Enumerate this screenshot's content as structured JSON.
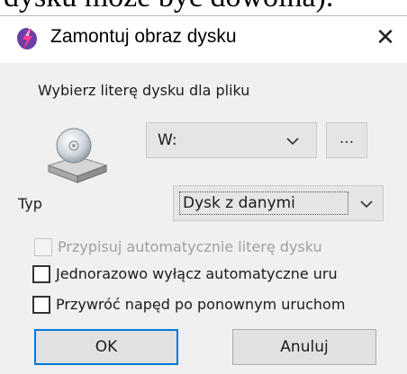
{
  "background_text": "dysku może być dowolna).",
  "dialog": {
    "title": "Zamontuj obraz dysku",
    "close_label": "✕",
    "drive_letter_label": "Wybierz literę dysku dla pliku",
    "drive_letter_value": "W:",
    "browse_label": "...",
    "type_label": "Typ",
    "type_value": "Dysk z danymi",
    "checkbox_auto_assign": "Przypisuj automatycznie literę dysku",
    "checkbox_disable_autorun": "Jednorazowo wyłącz automatyczne uru",
    "checkbox_restore_drive": "Przywróć napęd po ponownym uruchom",
    "ok_label": "OK",
    "cancel_label": "Anuluj"
  },
  "colors": {
    "dialog_bg": "#f0f0f0",
    "titlebar_bg": "#ffffff",
    "default_button_border": "#0078d7"
  },
  "icons": {
    "app": "daemon-tools-lightning-icon",
    "drive": "optical-drive-icon",
    "close": "close-icon",
    "dropdown": "chevron-down-icon"
  }
}
